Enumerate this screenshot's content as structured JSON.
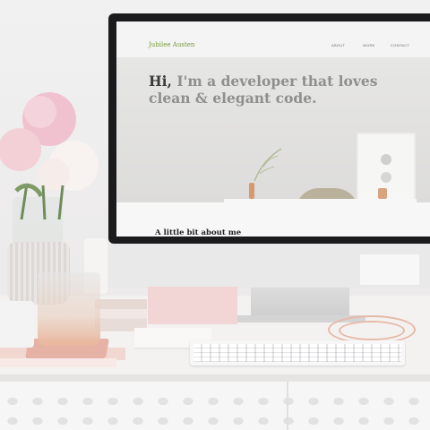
{
  "website": {
    "brand": "Jubilee Austen",
    "nav": {
      "about": "ABOUT",
      "work": "WORK",
      "contact": "CONTACT"
    },
    "hero": {
      "greeting": "Hi,",
      "title_rest": " I'm a developer that loves clean & elegant code."
    },
    "about": {
      "title": "A little bit about me"
    }
  },
  "colors": {
    "brand": "#7a9a3a",
    "hero_text": "#8f8f8f",
    "greeting_text": "#3a3a3a"
  },
  "icons": {
    "flowers": "peony-bouquet",
    "glass": "drinking-glass",
    "keyboard": "keyboard"
  }
}
